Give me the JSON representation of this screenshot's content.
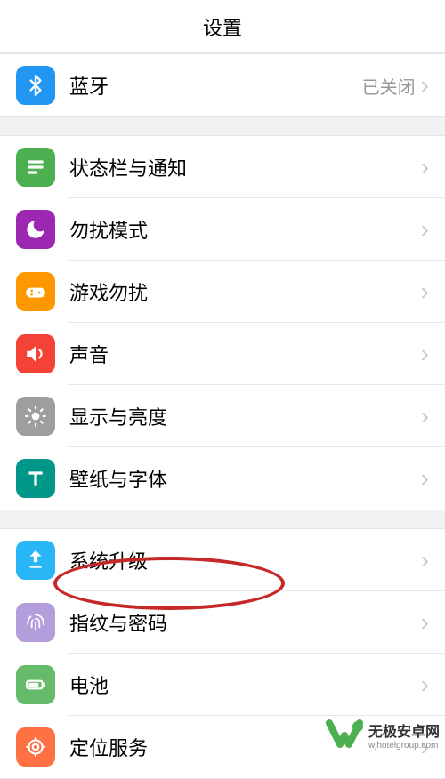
{
  "header": {
    "title": "设置"
  },
  "sections": [
    {
      "rows": [
        {
          "key": "bluetooth",
          "label": "蓝牙",
          "value": "已关闭",
          "icon": "bluetooth",
          "color": "bg-blue"
        }
      ]
    },
    {
      "rows": [
        {
          "key": "statusbar-notif",
          "label": "状态栏与通知",
          "icon": "list",
          "color": "bg-green"
        },
        {
          "key": "dnd",
          "label": "勿扰模式",
          "icon": "moon",
          "color": "bg-purple"
        },
        {
          "key": "game-dnd",
          "label": "游戏勿扰",
          "icon": "gamepad",
          "color": "bg-orange"
        },
        {
          "key": "sound",
          "label": "声音",
          "icon": "speaker",
          "color": "bg-red"
        },
        {
          "key": "display",
          "label": "显示与亮度",
          "icon": "brightness",
          "color": "bg-gray"
        },
        {
          "key": "wallpaper-font",
          "label": "壁纸与字体",
          "icon": "text",
          "color": "bg-teal"
        }
      ]
    },
    {
      "rows": [
        {
          "key": "system-update",
          "label": "系统升级",
          "icon": "update",
          "color": "bg-lightblue"
        },
        {
          "key": "fingerprint-password",
          "label": "指纹与密码",
          "icon": "fingerprint",
          "color": "bg-violet"
        },
        {
          "key": "battery",
          "label": "电池",
          "icon": "battery",
          "color": "bg-greenlight"
        },
        {
          "key": "location",
          "label": "定位服务",
          "icon": "location",
          "color": "bg-deeporange"
        }
      ]
    }
  ],
  "chevron": "›",
  "highlight_target": "fingerprint-password",
  "watermark": {
    "line1": "无极安卓网",
    "line2": "wjhotelgroup.com"
  }
}
